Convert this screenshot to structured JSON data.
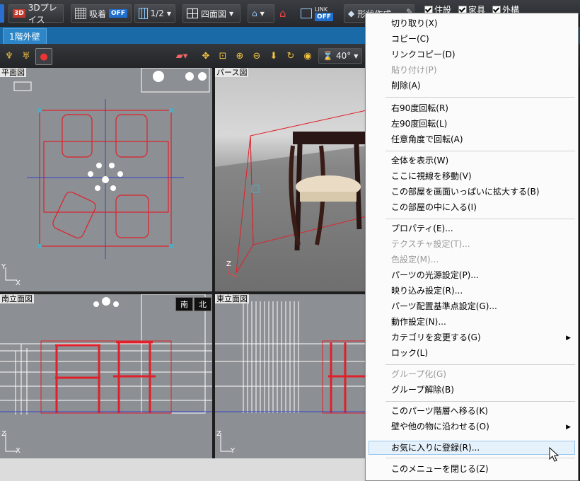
{
  "toolbar": {
    "btn_3d": "3Dプレイス",
    "snap_label": "吸着",
    "snap_state": "OFF",
    "grid_value": "1/2",
    "view_mode": "四面図",
    "link_label": "LINK",
    "link_state": "OFF",
    "shape_create": "形状作成",
    "checks": [
      "住設",
      "家具",
      "外構"
    ]
  },
  "tabs": [
    "1階外壁"
  ],
  "view_toolbar": {
    "angle": "40°"
  },
  "panes": {
    "plan": {
      "label": "平面図",
      "axis_y": "Y",
      "axis_x": "X"
    },
    "perspective": {
      "label": "パース図",
      "axis_z": "Z"
    },
    "south": {
      "label": "南立面図",
      "axis_z": "Z",
      "axis_x": "X",
      "toggle_a": "南",
      "toggle_b": "北"
    },
    "east": {
      "label": "東立面図",
      "axis_z": "Z",
      "axis_y": "Y"
    }
  },
  "menu": {
    "items": [
      {
        "label": "切り取り(X)",
        "disabled": false
      },
      {
        "label": "コピー(C)",
        "disabled": false
      },
      {
        "label": "リンクコピー(D)",
        "disabled": false
      },
      {
        "label": "貼り付け(P)",
        "disabled": true
      },
      {
        "label": "削除(A)",
        "disabled": false
      },
      {
        "label": "右90度回転(R)",
        "disabled": false
      },
      {
        "label": "左90度回転(L)",
        "disabled": false
      },
      {
        "label": "任意角度で回転(A)",
        "disabled": false
      },
      {
        "label": "全体を表示(W)",
        "disabled": false
      },
      {
        "label": "ここに視線を移動(V)",
        "disabled": false
      },
      {
        "label": "この部屋を画面いっぱいに拡大する(B)",
        "disabled": false
      },
      {
        "label": "この部屋の中に入る(I)",
        "disabled": false
      },
      {
        "label": "プロパティ(E)...",
        "disabled": false
      },
      {
        "label": "テクスチャ設定(T)...",
        "disabled": true
      },
      {
        "label": "色設定(M)...",
        "disabled": true
      },
      {
        "label": "パーツの光源設定(P)...",
        "disabled": false
      },
      {
        "label": "映り込み設定(R)...",
        "disabled": false
      },
      {
        "label": "パーツ配置基準点設定(G)...",
        "disabled": false
      },
      {
        "label": "動作設定(N)...",
        "disabled": false
      },
      {
        "label": "カテゴリを変更する(G)",
        "disabled": false,
        "submenu": true
      },
      {
        "label": "ロック(L)",
        "disabled": false
      },
      {
        "label": "グループ化(G)",
        "disabled": true
      },
      {
        "label": "グループ解除(B)",
        "disabled": false
      },
      {
        "label": "このパーツ階層へ移る(K)",
        "disabled": false
      },
      {
        "label": "壁や他の物に沿わせる(O)",
        "disabled": false,
        "submenu": true
      },
      {
        "label": "お気に入りに登録(R)...",
        "disabled": false,
        "highlighted": true
      },
      {
        "label": "このメニューを閉じる(Z)",
        "disabled": false
      }
    ]
  },
  "colors": {
    "accent_tab": "#1a6aa8",
    "selection_red": "#e0202a",
    "badge_blue": "#1e6fd0"
  }
}
